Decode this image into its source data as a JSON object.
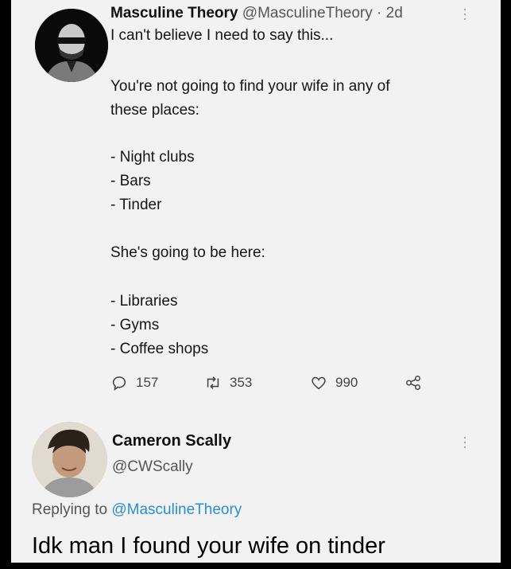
{
  "tweet": {
    "author_name": "Masculine Theory",
    "author_handle": "@MasculineTheory",
    "time": "· 2d",
    "lines": [
      "I can't believe I need to say this...",
      "You're not going to find your wife in any of",
      "these places:",
      "- Night clubs",
      "- Bars",
      "- Tinder",
      "She's going to be here:",
      "- Libraries",
      "- Gyms",
      "- Coffee shops"
    ],
    "replies_count": "157",
    "retweets_count": "353",
    "likes_count": "990"
  },
  "reply": {
    "author_name": "Cameron Scally",
    "author_handle": "@CWScally",
    "replying_prefix": "Replying to",
    "replying_mention": "@MasculineTheory",
    "text": "Idk man I found your wife on tinder"
  },
  "icons": {
    "reply": "speech-bubble-icon",
    "retweet": "retweet-icon",
    "like": "heart-icon",
    "share": "share-icon",
    "more": "more-vertical-icon"
  },
  "colors": {
    "background": "#000000",
    "card": "#f2f2f2",
    "mention": "#2a8ed6"
  }
}
